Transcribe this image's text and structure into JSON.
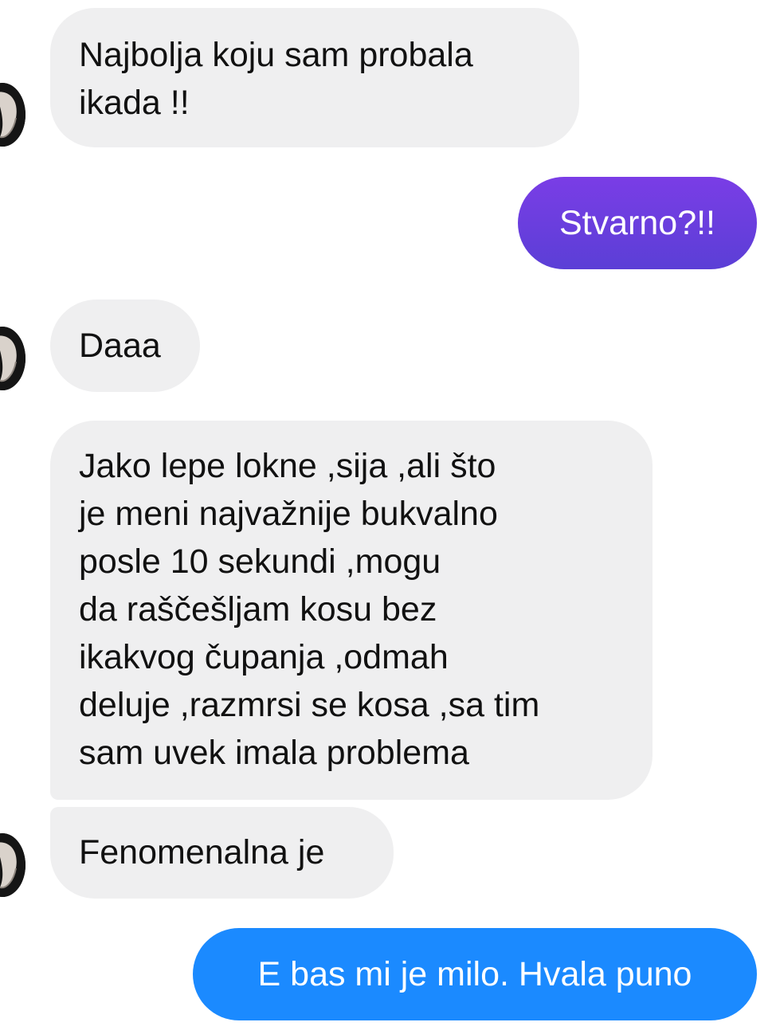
{
  "colors": {
    "incoming_bubble": "#efeff0",
    "outgoing_purple_top": "#7a3de6",
    "outgoing_purple_bottom": "#5b3fd6",
    "outgoing_blue": "#1b8aff",
    "incoming_text": "#111111",
    "outgoing_text": "#ffffff"
  },
  "conversation": {
    "messages": [
      {
        "direction": "incoming",
        "text": "Najbolja koju sam probala\nikada !!"
      },
      {
        "direction": "outgoing",
        "text": "Stvarno?!!"
      },
      {
        "direction": "incoming",
        "text": "Daaa"
      },
      {
        "direction": "incoming",
        "text": "Jako lepe lokne ,sija ,ali što\nje meni najvažnije bukvalno\nposle 10 sekundi ,mogu\nda raščešljam kosu bez\nikakvog čupanja ,odmah\ndeluje ,razmrsi se kosa ,sa tim\nsam uvek imala problema"
      },
      {
        "direction": "incoming",
        "text": "Fenomenalna je"
      },
      {
        "direction": "outgoing",
        "text": "E bas mi je milo. Hvala puno"
      }
    ]
  },
  "icons": {
    "avatar": "contact-avatar-icon"
  }
}
